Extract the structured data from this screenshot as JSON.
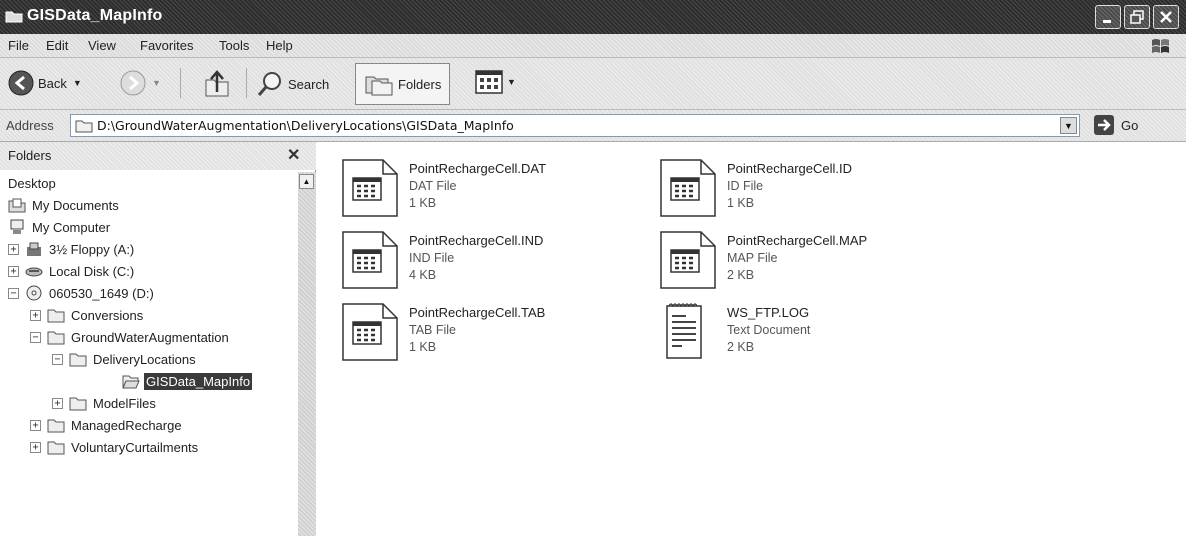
{
  "window": {
    "title": "GISData_MapInfo",
    "buttons": [
      "minimize",
      "maximize",
      "close"
    ]
  },
  "menubar": {
    "items": [
      "File",
      "Edit",
      "View",
      "Favorites",
      "Tools",
      "Help"
    ]
  },
  "toolbar": {
    "back_label": "Back",
    "search_label": "Search",
    "folders_label": "Folders"
  },
  "address": {
    "label": "Address",
    "value": "D:\\GroundWaterAugmentation\\DeliveryLocations\\GISData_MapInfo",
    "go_label": "Go"
  },
  "folders_pane": {
    "title": "Folders",
    "tree": [
      {
        "label": "Desktop",
        "icon": "none",
        "expander": ""
      },
      {
        "label": "My Documents",
        "icon": "my-documents-icon",
        "expander": ""
      },
      {
        "label": "My Computer",
        "icon": "computer-icon",
        "expander": ""
      },
      {
        "label": "3½ Floppy (A:)",
        "icon": "floppy-icon",
        "expander": "+"
      },
      {
        "label": "Local Disk (C:)",
        "icon": "disk-icon",
        "expander": "+"
      },
      {
        "label": "060530_1649 (D:)",
        "icon": "cd-icon",
        "expander": "−"
      },
      {
        "label": "Conversions",
        "icon": "folder-icon",
        "expander": "+"
      },
      {
        "label": "GroundWaterAugmentation",
        "icon": "folder-icon",
        "expander": "−"
      },
      {
        "label": "DeliveryLocations",
        "icon": "folder-icon",
        "expander": "−"
      },
      {
        "label": "GISData_MapInfo",
        "icon": "open-folder-icon",
        "expander": "",
        "selected": true
      },
      {
        "label": "ModelFiles",
        "icon": "folder-icon",
        "expander": "+"
      },
      {
        "label": "ManagedRecharge",
        "icon": "folder-icon",
        "expander": "+"
      },
      {
        "label": "VoluntaryCurtailments",
        "icon": "folder-icon",
        "expander": "+"
      }
    ]
  },
  "files": [
    {
      "name": "PointRechargeCell.DAT",
      "type": "DAT File",
      "size": "1 KB",
      "icon": "data-file-icon"
    },
    {
      "name": "PointRechargeCell.ID",
      "type": "ID File",
      "size": "1 KB",
      "icon": "data-file-icon"
    },
    {
      "name": "PointRechargeCell.IND",
      "type": "IND File",
      "size": "4 KB",
      "icon": "data-file-icon"
    },
    {
      "name": "PointRechargeCell.MAP",
      "type": "MAP File",
      "size": "2 KB",
      "icon": "data-file-icon"
    },
    {
      "name": "PointRechargeCell.TAB",
      "type": "TAB File",
      "size": "1 KB",
      "icon": "data-file-icon"
    },
    {
      "name": "WS_FTP.LOG",
      "type": "Text Document",
      "size": "2 KB",
      "icon": "text-document-icon"
    }
  ]
}
